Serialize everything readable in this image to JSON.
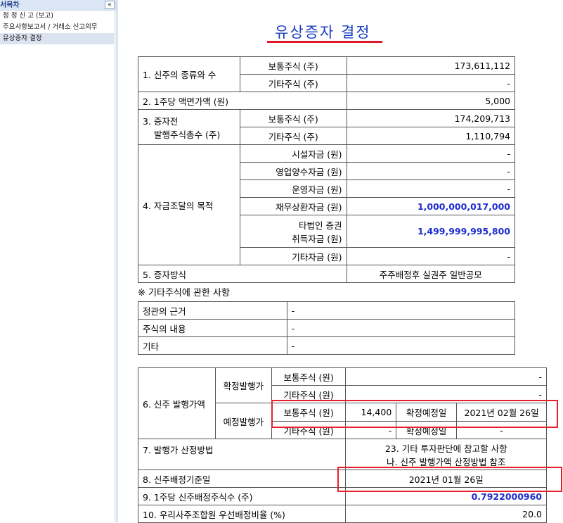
{
  "sidebar": {
    "header": "서목차",
    "collapse_glyph": "«",
    "items": [
      {
        "label": "정 정 신 고 (보고)"
      },
      {
        "label": "주요사항보고서 / 거래소 신고의무"
      },
      {
        "label": "유상증자 결정"
      }
    ]
  },
  "doc": {
    "title": "유상증자 결정"
  },
  "table1": {
    "r1_label": "1. 신주의 종류와 수",
    "r1a_sub": "보통주식 (주)",
    "r1a_val": "173,611,112",
    "r1b_sub": "기타주식 (주)",
    "r1b_val": "-",
    "r2_label": "2. 1주당 액면가액 (원)",
    "r2_val": "5,000",
    "r3_label_1": "3. 증자전",
    "r3_label_2": "발행주식총수 (주)",
    "r3a_sub": "보통주식 (주)",
    "r3a_val": "174,209,713",
    "r3b_sub": "기타주식 (주)",
    "r3b_val": "1,110,794",
    "r4_label": "4. 자금조달의 목적",
    "r4a_sub": "시설자금 (원)",
    "r4a_val": "-",
    "r4b_sub": "영업양수자금 (원)",
    "r4b_val": "-",
    "r4c_sub": "운영자금 (원)",
    "r4c_val": "-",
    "r4d_sub": "채무상환자금 (원)",
    "r4d_val": "1,000,000,017,000",
    "r4e_sub_1": "타법인 증권",
    "r4e_sub_2": "취득자금 (원)",
    "r4e_val": "1,499,999,995,800",
    "r4f_sub": "기타자금 (원)",
    "r4f_val": "-",
    "r5_label": "5. 증자방식",
    "r5_val": "주주배정후 실권주 일반공모"
  },
  "note": "※ 기타주식에 관한 사항",
  "table2": {
    "rows": [
      {
        "label": "정관의 근거",
        "value": "-"
      },
      {
        "label": "주식의 내용",
        "value": "-"
      },
      {
        "label": "기타",
        "value": "-"
      }
    ]
  },
  "table3": {
    "r6_label": "6. 신주 발행가액",
    "confirmed_label": "확정발행가",
    "expected_label": "예정발행가",
    "c_common_sub": "보통주식 (원)",
    "c_common_val": "-",
    "c_other_sub": "기타주식 (원)",
    "c_other_val": "-",
    "e_common_sub": "보통주식 (원)",
    "e_common_val": "14,400",
    "e_common_date_label": "확정예정일",
    "e_common_date": "2021년 02월 26일",
    "e_other_sub": "기타주식 (원)",
    "e_other_val": "-",
    "e_other_date_label": "확정예정일",
    "e_other_date": "-",
    "r7_label": "7. 발행가 산정방법",
    "r7_val_1": "23. 기타 투자판단에 참고할 사항",
    "r7_val_2": "나. 신주 발행가액 산정방법 참조",
    "r8_label": "8. 신주배정기준일",
    "r8_val": "2021년 01월 26일",
    "r9_label": "9. 1주당 신주배정주식수 (주)",
    "r9_val": "0.7922000960",
    "r10_label": "10. 우리사주조합원 우선배정비율 (%)",
    "r10_val": "20.0"
  },
  "colors": {
    "title": "#1a3ec0",
    "underline": "#e0192a",
    "highlight_box": "#e8202c",
    "emphasis_value": "#1f2ccf"
  }
}
